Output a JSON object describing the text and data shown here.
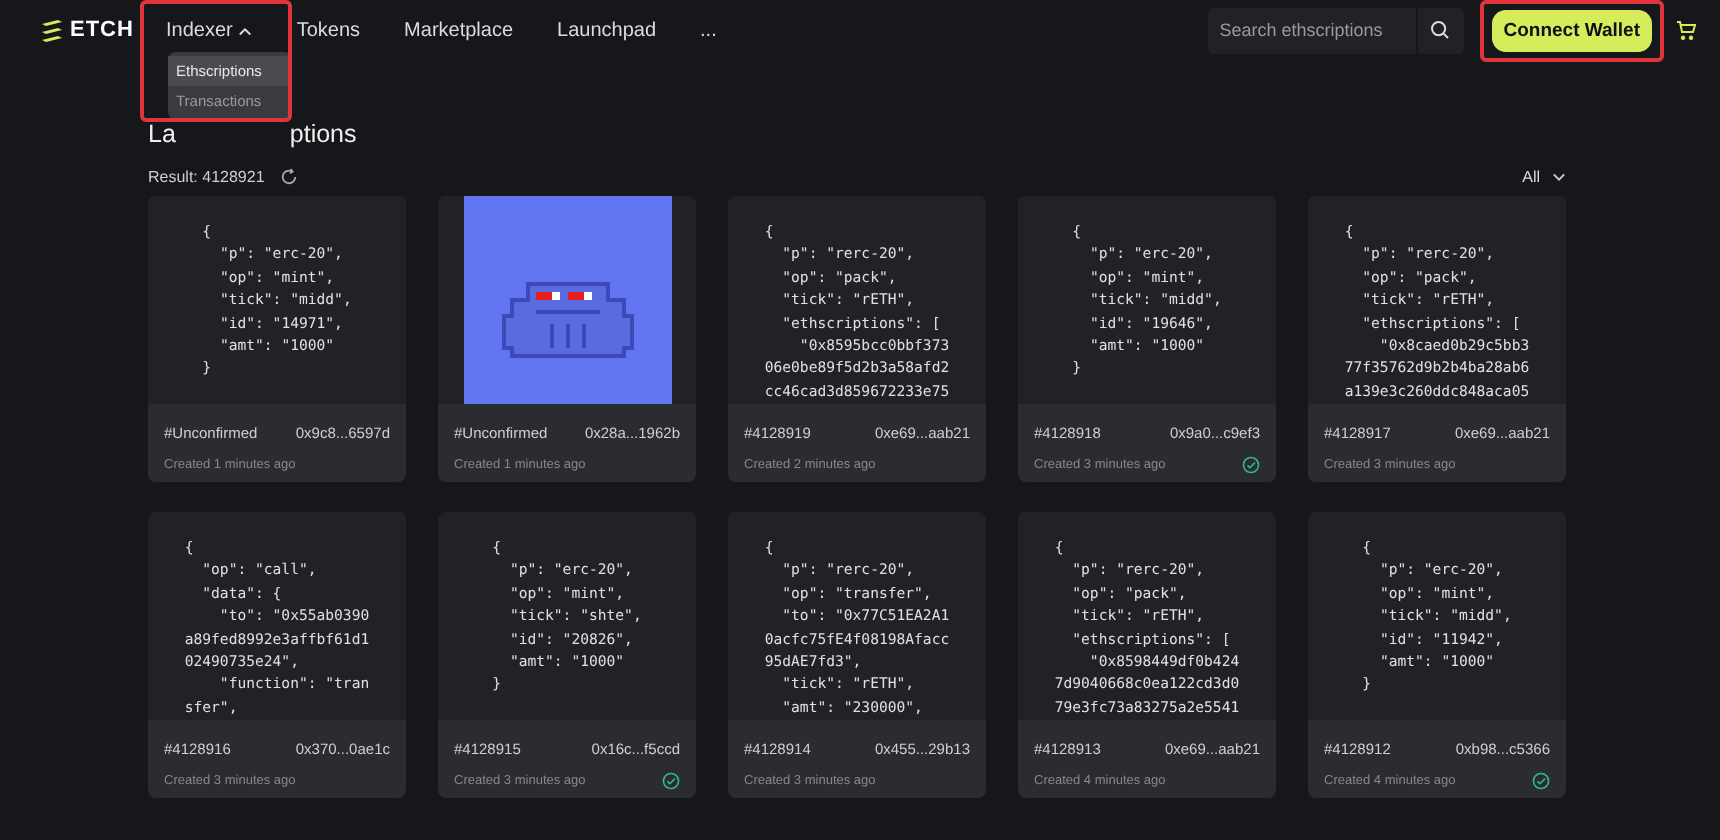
{
  "header": {
    "logo": "ETCH",
    "nav": [
      {
        "label": "Indexer",
        "expanded": true,
        "highlighted": true,
        "menu": [
          {
            "label": "Ethscriptions",
            "selected": true
          },
          {
            "label": "Transactions",
            "selected": false
          }
        ]
      },
      {
        "label": "Tokens"
      },
      {
        "label": "Marketplace"
      },
      {
        "label": "Launchpad"
      },
      {
        "label": "..."
      }
    ],
    "search": {
      "placeholder": "Search ethscriptions"
    },
    "connect_wallet": {
      "label": "Connect Wallet",
      "highlighted": true
    }
  },
  "heading_parts": [
    "La",
    "ptions"
  ],
  "result": "Result: 4128921",
  "filter": "All",
  "cards": [
    {
      "kind": "code",
      "code": [
        "{",
        "  \"p\": \"erc-20\",",
        "  \"op\": \"mint\",",
        "  \"tick\": \"midd\",",
        "  \"id\": \"14971\",",
        "  \"amt\": \"1000\"",
        "}"
      ],
      "number": "#Unconfirmed",
      "address": "0x9c8...6597d",
      "created": "Created 1 minutes ago",
      "verified": false
    },
    {
      "kind": "picture",
      "number": "#Unconfirmed",
      "address": "0x28a...1962b",
      "created": "Created 1 minutes ago",
      "verified": false
    },
    {
      "kind": "code",
      "code": [
        "{",
        "  \"p\": \"rerc-20\",",
        "  \"op\": \"pack\",",
        "  \"tick\": \"rETH\",",
        "  \"ethscriptions\": [",
        "    \"0x8595bcc0bbf373",
        "06e0be89f5d2b3a58afd2",
        "cc46cad3d859672233e75"
      ],
      "number": "#4128919",
      "address": "0xe69...aab21",
      "created": "Created 2 minutes ago",
      "verified": false
    },
    {
      "kind": "code",
      "code": [
        "{",
        "  \"p\": \"erc-20\",",
        "  \"op\": \"mint\",",
        "  \"tick\": \"midd\",",
        "  \"id\": \"19646\",",
        "  \"amt\": \"1000\"",
        "}"
      ],
      "number": "#4128918",
      "address": "0x9a0...c9ef3",
      "created": "Created 3 minutes ago",
      "verified": true
    },
    {
      "kind": "code",
      "code": [
        "{",
        "  \"p\": \"rerc-20\",",
        "  \"op\": \"pack\",",
        "  \"tick\": \"rETH\",",
        "  \"ethscriptions\": [",
        "    \"0x8caed0b29c5bb3",
        "77f35762d9b2b4ba28ab6",
        "a139e3c260ddc848aca05"
      ],
      "number": "#4128917",
      "address": "0xe69...aab21",
      "created": "Created 3 minutes ago",
      "verified": false
    },
    {
      "kind": "code",
      "code": [
        "{",
        "  \"op\": \"call\",",
        "  \"data\": {",
        "    \"to\": \"0x55ab0390",
        "a89fed8992e3affbf61d1",
        "02490735e24\",",
        "    \"function\": \"tran",
        "sfer\","
      ],
      "number": "#4128916",
      "address": "0x370...0ae1c",
      "created": "Created 3 minutes ago",
      "verified": false
    },
    {
      "kind": "code",
      "code": [
        "{",
        "  \"p\": \"erc-20\",",
        "  \"op\": \"mint\",",
        "  \"tick\": \"shte\",",
        "  \"id\": \"20826\",",
        "  \"amt\": \"1000\"",
        "}"
      ],
      "number": "#4128915",
      "address": "0x16c...f5ccd",
      "created": "Created 3 minutes ago",
      "verified": true
    },
    {
      "kind": "code",
      "code": [
        "{",
        "  \"p\": \"rerc-20\",",
        "  \"op\": \"transfer\",",
        "  \"to\": \"0x77C51EA2A1",
        "0acfc75fE4f08198Afacc",
        "95dAE7fd3\",",
        "  \"tick\": \"rETH\",",
        "  \"amt\": \"230000\","
      ],
      "number": "#4128914",
      "address": "0x455...29b13",
      "created": "Created 3 minutes ago",
      "verified": false
    },
    {
      "kind": "code",
      "code": [
        "{",
        "  \"p\": \"rerc-20\",",
        "  \"op\": \"pack\",",
        "  \"tick\": \"rETH\",",
        "  \"ethscriptions\": [",
        "    \"0x8598449df0b424",
        "7d9040668c0ea122cd3d0",
        "79e3fc73a83275a2e5541"
      ],
      "number": "#4128913",
      "address": "0xe69...aab21",
      "created": "Created 4 minutes ago",
      "verified": false
    },
    {
      "kind": "code",
      "code": [
        "{",
        "  \"p\": \"erc-20\",",
        "  \"op\": \"mint\",",
        "  \"tick\": \"midd\",",
        "  \"id\": \"11942\",",
        "  \"amt\": \"1000\"",
        "}"
      ],
      "number": "#4128912",
      "address": "0xb98...c5366",
      "created": "Created 4 minutes ago",
      "verified": true
    }
  ]
}
